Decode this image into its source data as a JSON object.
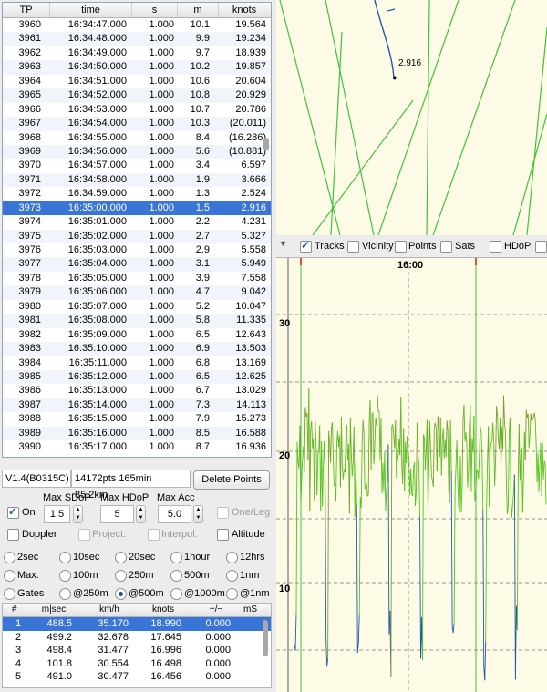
{
  "tp_table": {
    "columns": [
      "TP",
      "time",
      "s",
      "m",
      "knots"
    ],
    "rows": [
      [
        "3960",
        "16:34:47.000",
        "1.000",
        "10.1",
        "19.564"
      ],
      [
        "3961",
        "16:34:48.000",
        "1.000",
        "9.9",
        "19.234"
      ],
      [
        "3962",
        "16:34:49.000",
        "1.000",
        "9.7",
        "18.939"
      ],
      [
        "3963",
        "16:34:50.000",
        "1.000",
        "10.2",
        "19.857"
      ],
      [
        "3964",
        "16:34:51.000",
        "1.000",
        "10.6",
        "20.604"
      ],
      [
        "3965",
        "16:34:52.000",
        "1.000",
        "10.8",
        "20.929"
      ],
      [
        "3966",
        "16:34:53.000",
        "1.000",
        "10.7",
        "20.786"
      ],
      [
        "3967",
        "16:34:54.000",
        "1.000",
        "10.3",
        "(20.011)"
      ],
      [
        "3968",
        "16:34:55.000",
        "1.000",
        "8.4",
        "(16.286)"
      ],
      [
        "3969",
        "16:34:56.000",
        "1.000",
        "5.6",
        "(10.881)"
      ],
      [
        "3970",
        "16:34:57.000",
        "1.000",
        "3.4",
        "6.597"
      ],
      [
        "3971",
        "16:34:58.000",
        "1.000",
        "1.9",
        "3.666"
      ],
      [
        "3972",
        "16:34:59.000",
        "1.000",
        "1.3",
        "2.524"
      ],
      [
        "3973",
        "16:35:00.000",
        "1.000",
        "1.5",
        "2.916"
      ],
      [
        "3974",
        "16:35:01.000",
        "1.000",
        "2.2",
        "4.231"
      ],
      [
        "3975",
        "16:35:02.000",
        "1.000",
        "2.7",
        "5.327"
      ],
      [
        "3976",
        "16:35:03.000",
        "1.000",
        "2.9",
        "5.558"
      ],
      [
        "3977",
        "16:35:04.000",
        "1.000",
        "3.1",
        "5.949"
      ],
      [
        "3978",
        "16:35:05.000",
        "1.000",
        "3.9",
        "7.558"
      ],
      [
        "3979",
        "16:35:06.000",
        "1.000",
        "4.7",
        "9.042"
      ],
      [
        "3980",
        "16:35:07.000",
        "1.000",
        "5.2",
        "10.047"
      ],
      [
        "3981",
        "16:35:08.000",
        "1.000",
        "5.8",
        "11.335"
      ],
      [
        "3982",
        "16:35:09.000",
        "1.000",
        "6.5",
        "12.643"
      ],
      [
        "3983",
        "16:35:10.000",
        "1.000",
        "6.9",
        "13.503"
      ],
      [
        "3984",
        "16:35:11.000",
        "1.000",
        "6.8",
        "13.169"
      ],
      [
        "3985",
        "16:35:12.000",
        "1.000",
        "6.5",
        "12.625"
      ],
      [
        "3986",
        "16:35:13.000",
        "1.000",
        "6.7",
        "13.029"
      ],
      [
        "3987",
        "16:35:14.000",
        "1.000",
        "7.3",
        "14.113"
      ],
      [
        "3988",
        "16:35:15.000",
        "1.000",
        "7.9",
        "15.273"
      ],
      [
        "3989",
        "16:35:16.000",
        "1.000",
        "8.5",
        "16.588"
      ],
      [
        "3990",
        "16:35:17.000",
        "1.000",
        "8.7",
        "16.936"
      ]
    ],
    "selected_tp": "3973"
  },
  "status": {
    "version": "V1.4(B0315C)",
    "summary": "14172pts 165min 85.2km",
    "delete_button": "Delete Points"
  },
  "filters": {
    "on_label": "On",
    "on_checked": true,
    "max_sdop_label": "Max SDoP",
    "max_sdop_value": "1.5",
    "max_hdop_label": "Max HDoP",
    "max_hdop_value": "5",
    "max_acc_label": "Max Acc",
    "max_acc_value": "5.0",
    "one_leg_label": "One/Leg",
    "doppler_label": "Doppler",
    "project_label": "Project.",
    "interpol_label": "Interpol.",
    "altitude_label": "Altitude"
  },
  "periods": {
    "row1": [
      "2sec",
      "10sec",
      "20sec",
      "1hour",
      "12hrs"
    ],
    "row2": [
      "Max.",
      "100m",
      "250m",
      "500m",
      "1nm"
    ],
    "row3": [
      "Gates",
      "@250m",
      "@500m",
      "@1000m",
      "@1nm"
    ],
    "selected": "@500m"
  },
  "results": {
    "columns": [
      "#",
      "m|sec",
      "km/h",
      "knots",
      "+/−",
      "mS"
    ],
    "rows": [
      [
        "1",
        "488.5",
        "35.170",
        "18.990",
        "0.000"
      ],
      [
        "2",
        "499.2",
        "32.678",
        "17.645",
        "0.000"
      ],
      [
        "3",
        "498.4",
        "31.477",
        "16.996",
        "0.000"
      ],
      [
        "4",
        "101.8",
        "30.554",
        "16.498",
        "0.000"
      ],
      [
        "5",
        "491.0",
        "30.477",
        "16.456",
        "0.000"
      ]
    ]
  },
  "map": {
    "point_label": "2.916"
  },
  "graph_options": {
    "tracks": "Tracks",
    "vicinity": "Vicinity",
    "points": "Points",
    "sats": "Sats",
    "hdop": "HDoP"
  },
  "graph": {
    "time_label": "16:00",
    "y_labels": [
      "30",
      "20",
      "10"
    ]
  },
  "colors": {
    "selection": "#3875d7",
    "track_green": "#52c41a",
    "track_blue": "#1f5aa8",
    "graph_bg": "#fdfbe6"
  }
}
